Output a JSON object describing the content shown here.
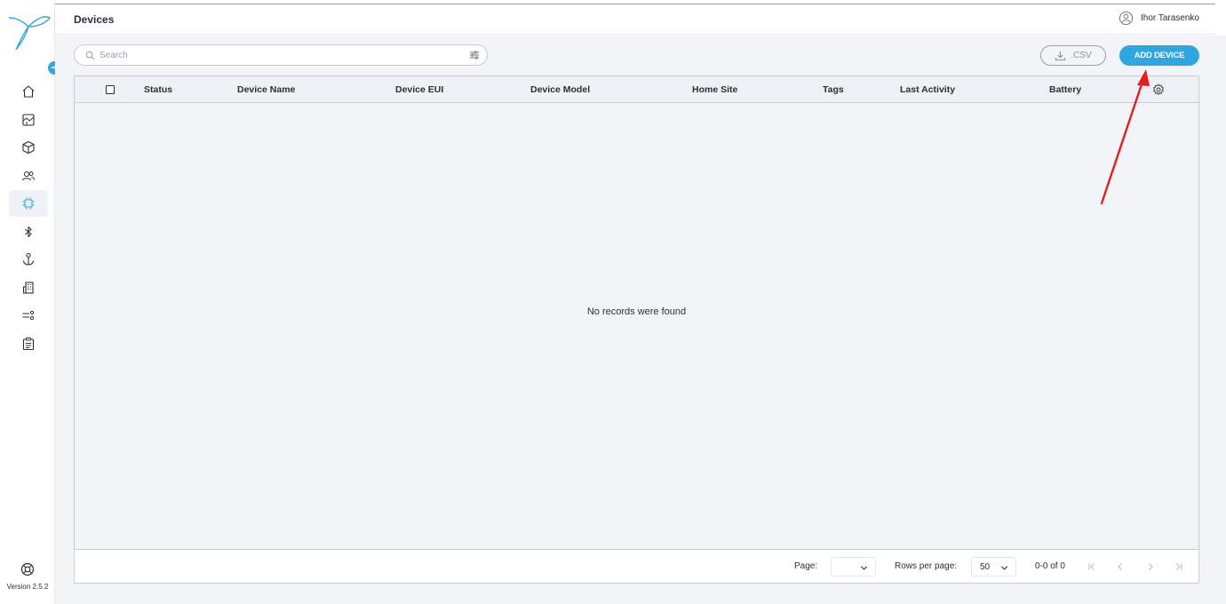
{
  "app": {
    "version": "Version 2.5.2",
    "brand_color": "#2ea6e0"
  },
  "sidebar": {
    "items": [
      {
        "name": "home",
        "icon": "home-icon"
      },
      {
        "name": "map",
        "icon": "map-icon"
      },
      {
        "name": "assets",
        "icon": "cube-icon"
      },
      {
        "name": "users",
        "icon": "users-icon"
      },
      {
        "name": "devices",
        "icon": "chip-icon",
        "active": true
      },
      {
        "name": "bluetooth",
        "icon": "bluetooth-icon"
      },
      {
        "name": "anchors",
        "icon": "anchor-icon"
      },
      {
        "name": "buildings",
        "icon": "building-icon"
      },
      {
        "name": "rules",
        "icon": "rules-icon"
      },
      {
        "name": "reports",
        "icon": "clipboard-icon"
      }
    ]
  },
  "header": {
    "title": "Devices",
    "user_name": "Ihor Tarasenko"
  },
  "toolbar": {
    "search_placeholder": "Search",
    "csv_label": ".CSV",
    "add_label": "ADD DEVICE"
  },
  "table": {
    "columns": [
      "Status",
      "Device Name",
      "Device EUI",
      "Device Model",
      "Home Site",
      "Tags",
      "Last Activity",
      "Battery"
    ],
    "rows": [],
    "empty_text": "No records were found"
  },
  "footer": {
    "page_label": "Page:",
    "page_value": "",
    "rows_label": "Rows per page:",
    "rows_value": "50",
    "range": "0-0 of 0"
  },
  "annotation": {
    "arrow_color": "#e02020"
  }
}
